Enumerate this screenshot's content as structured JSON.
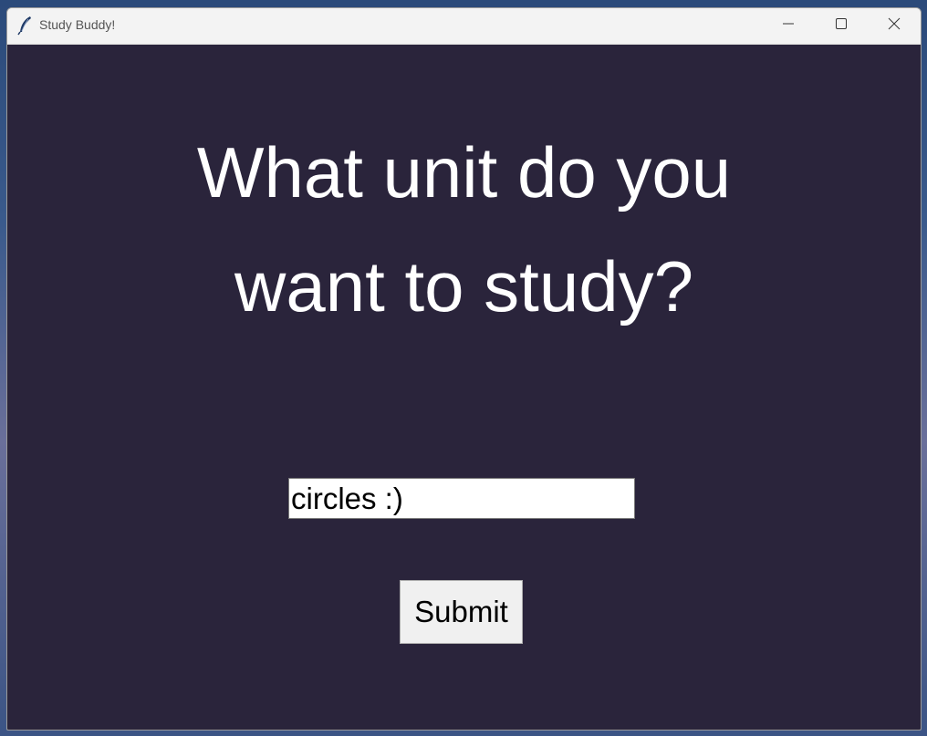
{
  "window": {
    "title": "Study Buddy!",
    "icon": "feather-icon"
  },
  "titlebar_controls": {
    "minimize_icon": "minimize-icon",
    "maximize_icon": "maximize-icon",
    "close_icon": "close-icon"
  },
  "main": {
    "question": "What unit do you\nwant to study?",
    "answer_value": "circles :)",
    "submit_label": "Submit"
  },
  "colors": {
    "background": "#2a243b",
    "text": "#ffffff"
  }
}
